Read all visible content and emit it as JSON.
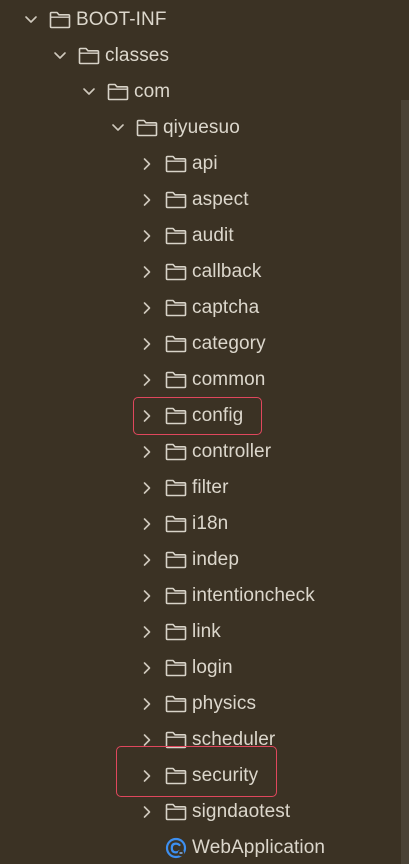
{
  "tree": [
    {
      "label": "BOOT-INF",
      "depth": 0,
      "state": "expanded",
      "icon": "folder-icon"
    },
    {
      "label": "classes",
      "depth": 1,
      "state": "expanded",
      "icon": "folder-icon"
    },
    {
      "label": "com",
      "depth": 2,
      "state": "expanded",
      "icon": "folder-icon"
    },
    {
      "label": "qiyuesuo",
      "depth": 3,
      "state": "expanded",
      "icon": "folder-icon"
    },
    {
      "label": "api",
      "depth": 4,
      "state": "collapsed",
      "icon": "folder-icon"
    },
    {
      "label": "aspect",
      "depth": 4,
      "state": "collapsed",
      "icon": "folder-icon"
    },
    {
      "label": "audit",
      "depth": 4,
      "state": "collapsed",
      "icon": "folder-icon"
    },
    {
      "label": "callback",
      "depth": 4,
      "state": "collapsed",
      "icon": "folder-icon"
    },
    {
      "label": "captcha",
      "depth": 4,
      "state": "collapsed",
      "icon": "folder-icon"
    },
    {
      "label": "category",
      "depth": 4,
      "state": "collapsed",
      "icon": "folder-icon"
    },
    {
      "label": "common",
      "depth": 4,
      "state": "collapsed",
      "icon": "folder-icon"
    },
    {
      "label": "config",
      "depth": 4,
      "state": "collapsed",
      "icon": "folder-icon"
    },
    {
      "label": "controller",
      "depth": 4,
      "state": "collapsed",
      "icon": "folder-icon"
    },
    {
      "label": "filter",
      "depth": 4,
      "state": "collapsed",
      "icon": "folder-icon"
    },
    {
      "label": "i18n",
      "depth": 4,
      "state": "collapsed",
      "icon": "folder-icon"
    },
    {
      "label": "indep",
      "depth": 4,
      "state": "collapsed",
      "icon": "folder-icon"
    },
    {
      "label": "intentioncheck",
      "depth": 4,
      "state": "collapsed",
      "icon": "folder-icon"
    },
    {
      "label": "link",
      "depth": 4,
      "state": "collapsed",
      "icon": "folder-icon"
    },
    {
      "label": "login",
      "depth": 4,
      "state": "collapsed",
      "icon": "folder-icon"
    },
    {
      "label": "physics",
      "depth": 4,
      "state": "collapsed",
      "icon": "folder-icon"
    },
    {
      "label": "scheduler",
      "depth": 4,
      "state": "collapsed",
      "icon": "folder-icon"
    },
    {
      "label": "security",
      "depth": 4,
      "state": "collapsed",
      "icon": "folder-icon"
    },
    {
      "label": "signdaotest",
      "depth": 4,
      "state": "collapsed",
      "icon": "folder-icon"
    },
    {
      "label": "WebApplication",
      "depth": 4,
      "state": "leaf",
      "icon": "java-class-icon"
    }
  ],
  "highlights": [
    "config",
    "security"
  ],
  "colors": {
    "background": "#3b3224",
    "text": "#dcd7cc",
    "highlight_border": "#e0475d",
    "java_class_icon": "#3d8ff0"
  }
}
